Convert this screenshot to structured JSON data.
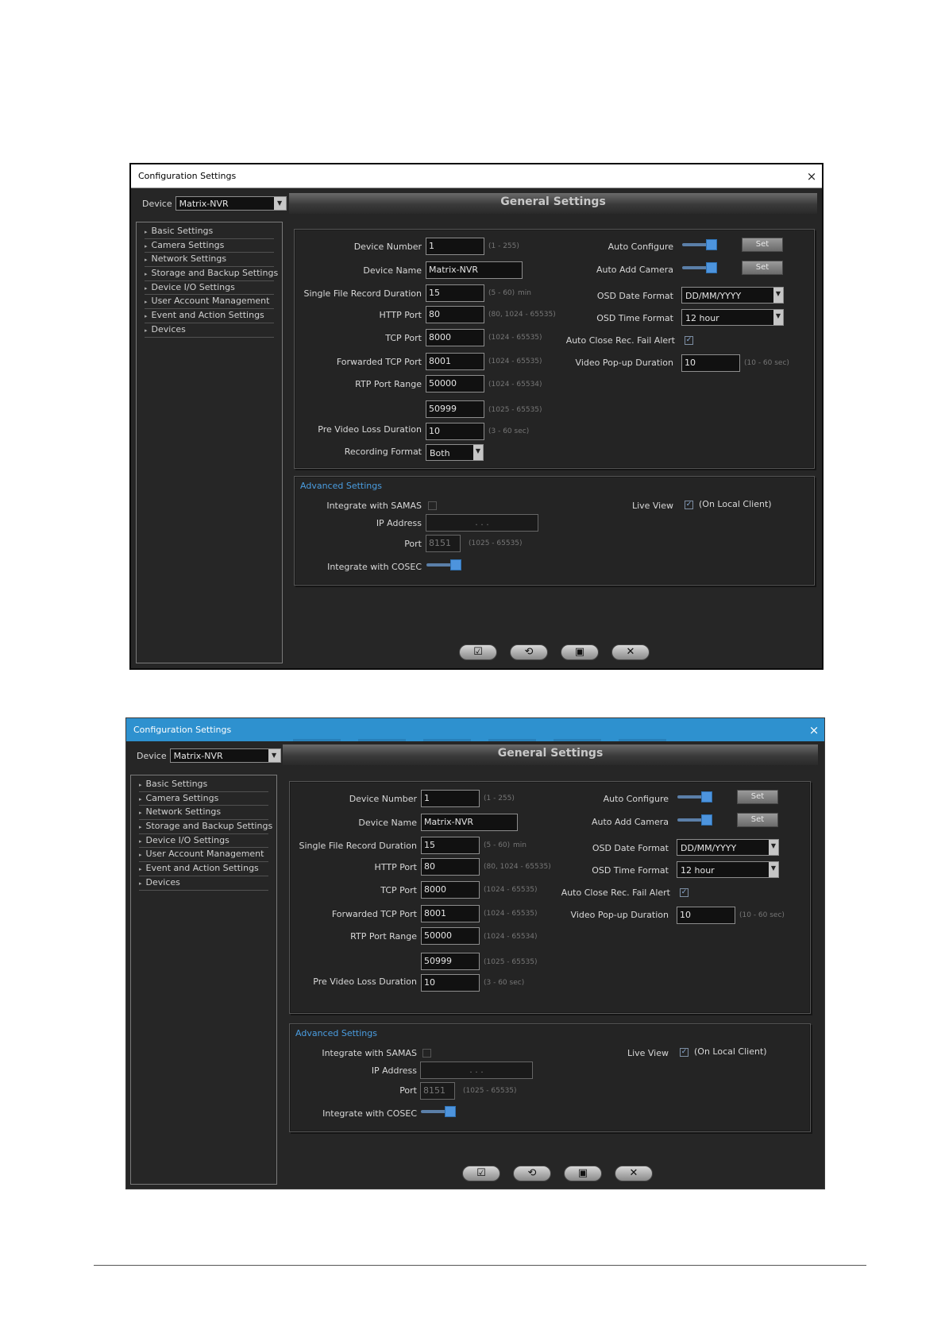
{
  "window": {
    "title": "Configuration Settings",
    "device_label": "Device",
    "device_value": "Matrix-NVR",
    "banner": "General Settings"
  },
  "nav": [
    "Basic Settings",
    "Camera Settings",
    "Network Settings",
    "Storage and Backup Settings",
    "Device I/O Settings",
    "User Account Management",
    "Event and Action Settings",
    "Devices"
  ],
  "general": {
    "device_number": {
      "label": "Device Number",
      "value": "1",
      "hint": "(1 - 255)"
    },
    "device_name": {
      "label": "Device Name",
      "value": "Matrix-NVR"
    },
    "single_file_record_duration": {
      "label": "Single File Record Duration",
      "value": "15",
      "hint": "(5 - 60)",
      "unit": "min"
    },
    "http_port": {
      "label": "HTTP Port",
      "value": "80",
      "hint": "(80, 1024 - 65535)"
    },
    "tcp_port": {
      "label": "TCP Port",
      "value": "8000",
      "hint": "(1024 - 65535)"
    },
    "forwarded_tcp_port": {
      "label": "Forwarded TCP Port",
      "value": "8001",
      "hint": "(1024 - 65535)"
    },
    "rtp_port_range": {
      "label": "RTP Port Range",
      "value_start": "50000",
      "hint_start": "(1024 - 65534)",
      "value_end": "50999",
      "hint_end": "(1025 - 65535)"
    },
    "pre_video_loss_duration": {
      "label": "Pre Video Loss Duration",
      "value": "10",
      "hint": "(3 - 60 sec)"
    },
    "recording_format": {
      "label": "Recording Format",
      "value": "Both"
    },
    "auto_configure": {
      "label": "Auto Configure",
      "button": "Set"
    },
    "auto_add_camera": {
      "label": "Auto Add Camera",
      "button": "Set"
    },
    "osd_date_format": {
      "label": "OSD Date Format",
      "value": "DD/MM/YYYY"
    },
    "osd_time_format": {
      "label": "OSD Time Format",
      "value": "12 hour"
    },
    "auto_close_rec_fail_alert": {
      "label": "Auto Close Rec. Fail Alert",
      "checked": true
    },
    "video_popup_duration": {
      "label": "Video Pop-up Duration",
      "value": "10",
      "hint": "(10 - 60 sec)"
    }
  },
  "advanced": {
    "title": "Advanced Settings",
    "integrate_samas": {
      "label": "Integrate with SAMAS",
      "checked": false
    },
    "ip_address": {
      "label": "IP Address",
      "value": ".      .      ."
    },
    "port": {
      "label": "Port",
      "value": "8151",
      "hint": "(1025 - 65535)"
    },
    "integrate_cosec": {
      "label": "Integrate with COSEC"
    },
    "live_view": {
      "label": "Live View",
      "checked": true,
      "note": "(On Local Client)"
    }
  },
  "icons": {
    "close": "×",
    "bullet": "▸",
    "dropdown": "▼",
    "check": "✓",
    "apply": "☑",
    "refresh": "⟲",
    "save": "▣",
    "cancel": "✕"
  }
}
